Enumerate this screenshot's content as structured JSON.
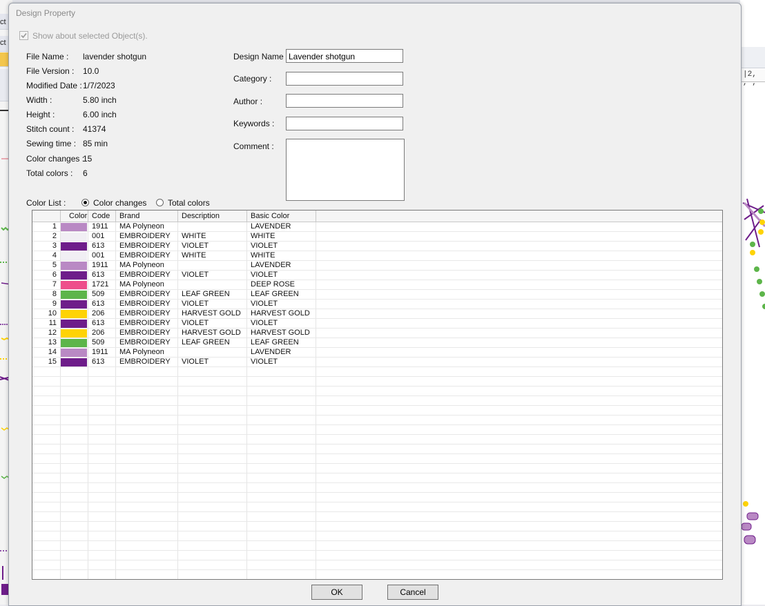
{
  "dialog": {
    "title": "Design Property",
    "show_selected_label": "Show about selected Object(s).",
    "show_selected_checked": true
  },
  "info": [
    {
      "label": "File Name :",
      "value": "lavender shotgun"
    },
    {
      "label": "File Version :",
      "value": "10.0"
    },
    {
      "label": "Modified Date :",
      "value": "1/7/2023"
    },
    {
      "label": "Width :",
      "value": "5.80 inch"
    },
    {
      "label": "Height :",
      "value": "6.00 inch"
    },
    {
      "label": "Stitch count :",
      "value": "41374"
    },
    {
      "label": "Sewing time :",
      "value": "85 min"
    },
    {
      "label": "Color changes :",
      "value": "15"
    },
    {
      "label": "Total colors :",
      "value": "6"
    }
  ],
  "form": {
    "design_name_label": "Design Name :",
    "design_name_value": "Lavender shotgun",
    "category_label": "Category :",
    "category_value": "",
    "author_label": "Author :",
    "author_value": "",
    "keywords_label": "Keywords :",
    "keywords_value": "",
    "comment_label": "Comment :",
    "comment_value": ""
  },
  "color_list": {
    "label": "Color List :",
    "option_changes": "Color changes",
    "option_total": "Total colors",
    "selected": "changes"
  },
  "table": {
    "headers": [
      "",
      "Color",
      "Code",
      "Brand",
      "Description",
      "Basic Color"
    ],
    "rows": [
      {
        "n": "1",
        "color": "#b989c4",
        "code": "1911",
        "brand": "MA Polyneon",
        "desc": "",
        "basic": "LAVENDER"
      },
      {
        "n": "2",
        "color": "#f1eff4",
        "code": "001",
        "brand": "EMBROIDERY",
        "desc": "WHITE",
        "basic": "WHITE"
      },
      {
        "n": "3",
        "color": "#6e1d8a",
        "code": "613",
        "brand": "EMBROIDERY",
        "desc": "VIOLET",
        "basic": "VIOLET"
      },
      {
        "n": "4",
        "color": "#f1eff4",
        "code": "001",
        "brand": "EMBROIDERY",
        "desc": "WHITE",
        "basic": "WHITE"
      },
      {
        "n": "5",
        "color": "#b989c4",
        "code": "1911",
        "brand": "MA Polyneon",
        "desc": "",
        "basic": "LAVENDER"
      },
      {
        "n": "6",
        "color": "#6e1d8a",
        "code": "613",
        "brand": "EMBROIDERY",
        "desc": "VIOLET",
        "basic": "VIOLET"
      },
      {
        "n": "7",
        "color": "#ee4e8b",
        "code": "1721",
        "brand": "MA Polyneon",
        "desc": "",
        "basic": "DEEP ROSE"
      },
      {
        "n": "8",
        "color": "#5db54a",
        "code": "509",
        "brand": "EMBROIDERY",
        "desc": "LEAF GREEN",
        "basic": "LEAF GREEN"
      },
      {
        "n": "9",
        "color": "#6e1d8a",
        "code": "613",
        "brand": "EMBROIDERY",
        "desc": "VIOLET",
        "basic": "VIOLET"
      },
      {
        "n": "10",
        "color": "#fed305",
        "code": "206",
        "brand": "EMBROIDERY",
        "desc": "HARVEST GOLD",
        "basic": "HARVEST GOLD"
      },
      {
        "n": "11",
        "color": "#6e1d8a",
        "code": "613",
        "brand": "EMBROIDERY",
        "desc": "VIOLET",
        "basic": "VIOLET"
      },
      {
        "n": "12",
        "color": "#fed305",
        "code": "206",
        "brand": "EMBROIDERY",
        "desc": "HARVEST GOLD",
        "basic": "HARVEST GOLD"
      },
      {
        "n": "13",
        "color": "#5db54a",
        "code": "509",
        "brand": "EMBROIDERY",
        "desc": "LEAF GREEN",
        "basic": "LEAF GREEN"
      },
      {
        "n": "14",
        "color": "#b989c4",
        "code": "1911",
        "brand": "MA Polyneon",
        "desc": "",
        "basic": "LAVENDER"
      },
      {
        "n": "15",
        "color": "#6e1d8a",
        "code": "613",
        "brand": "EMBROIDERY",
        "desc": "VIOLET",
        "basic": "VIOLET"
      }
    ]
  },
  "buttons": {
    "ok": "OK",
    "cancel": "Cancel"
  },
  "background": {
    "left_labels": [
      "ct",
      "ct"
    ],
    "ruler_text": "|2, , ,"
  }
}
